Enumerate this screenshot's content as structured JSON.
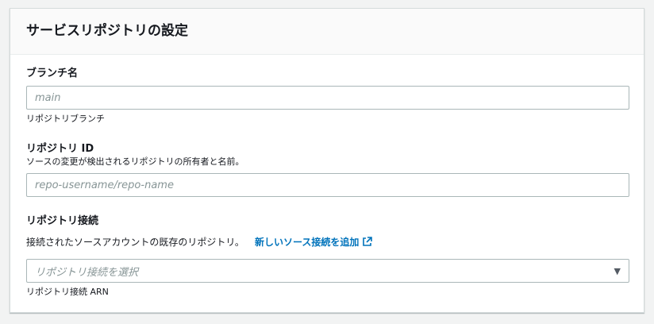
{
  "panel": {
    "title": "サービスリポジトリの設定"
  },
  "branch": {
    "label": "ブランチ名",
    "placeholder": "main",
    "hint": "リポジトリブランチ"
  },
  "repo_id": {
    "label": "リポジトリ ID",
    "description": "ソースの変更が検出されるリポジトリの所有者と名前。",
    "placeholder": "repo-username/repo-name"
  },
  "connection": {
    "label": "リポジトリ接続",
    "description": "接続されたソースアカウントの既存のリポジトリ。",
    "link_label": "新しいソース接続を追加",
    "link_icon": "external-link-icon",
    "select_placeholder": "リポジトリ接続を選択",
    "hint": "リポジトリ接続 ARN"
  },
  "colors": {
    "link": "#0073bb",
    "border": "#aab7b8"
  }
}
